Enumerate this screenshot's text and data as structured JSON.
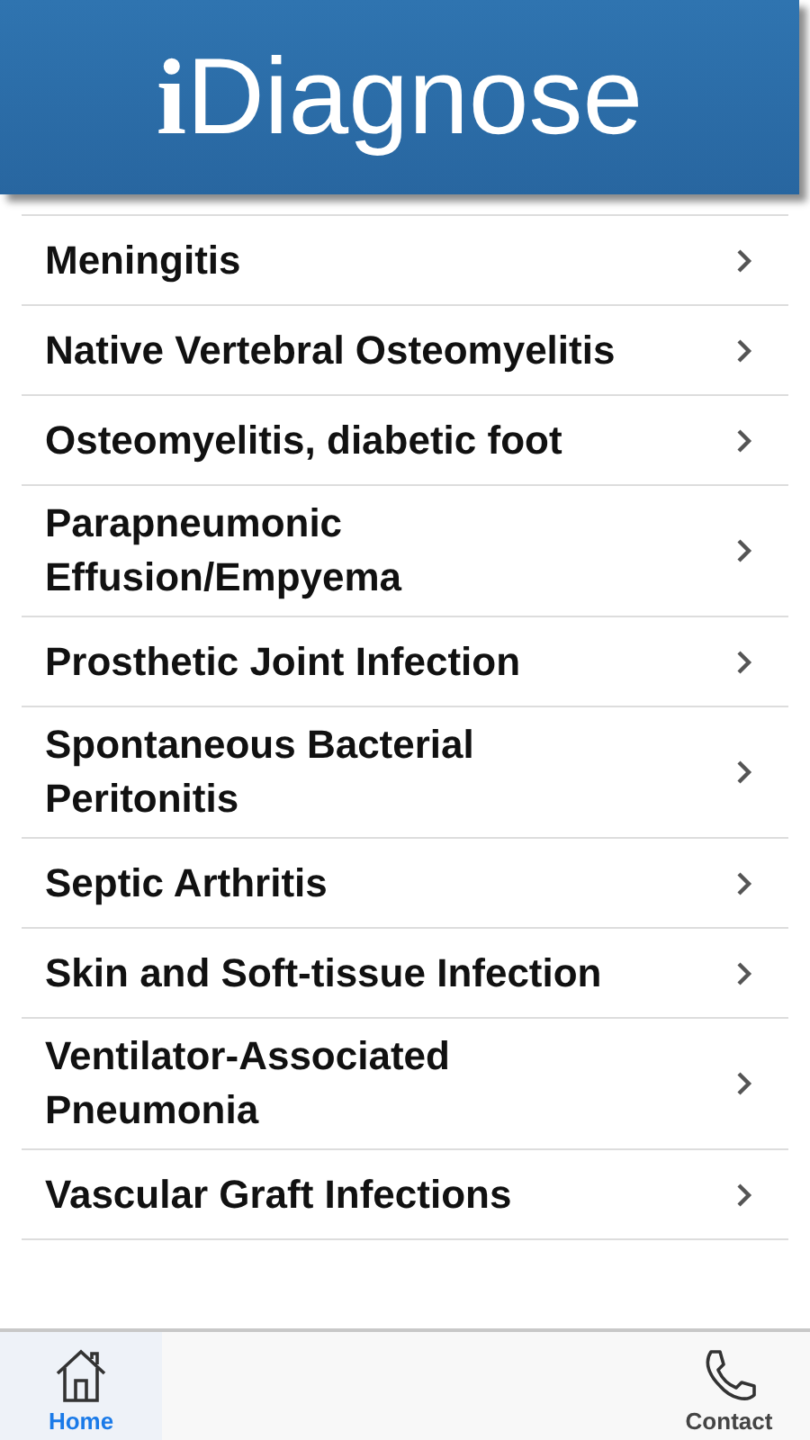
{
  "header": {
    "logo": "**i**Diagnose"
  },
  "items": [
    {
      "label": "Meningitis"
    },
    {
      "label": "Native Vertebral Osteomyelitis"
    },
    {
      "label": "Osteomyelitis, diabetic foot"
    },
    {
      "label": "Parapneumonic Effusion/Empyema"
    },
    {
      "label": "Prosthetic Joint Infection"
    },
    {
      "label": "Spontaneous Bacterial Peritonitis"
    },
    {
      "label": "Septic Arthritis"
    },
    {
      "label": "Skin and Soft-tissue Infection"
    },
    {
      "label": "Ventilator-Associated Pneumonia"
    },
    {
      "label": "Vascular Graft Infections"
    }
  ],
  "tabs": [
    {
      "kind": "home",
      "label": "Home",
      "selected": true
    },
    {
      "kind": "contact",
      "label": "Contact",
      "selected": false
    }
  ]
}
